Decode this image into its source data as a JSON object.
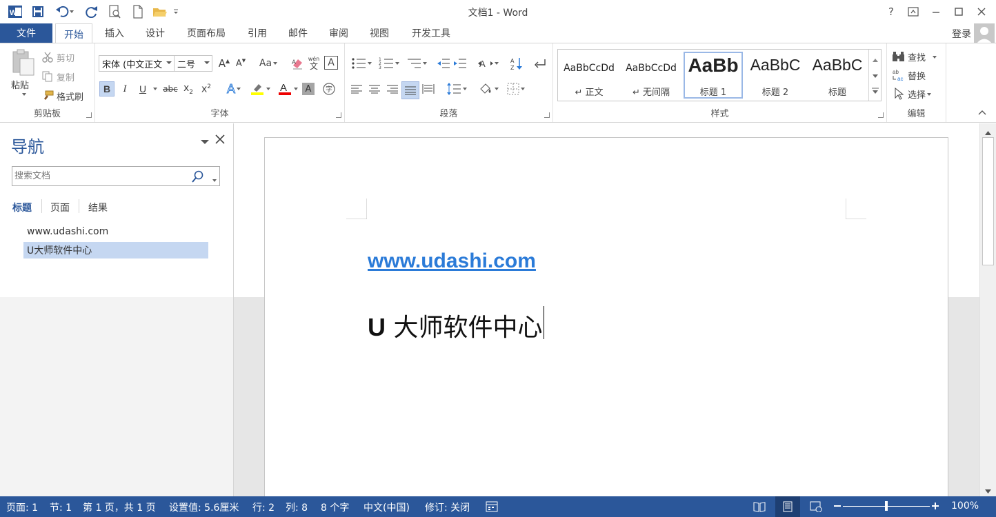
{
  "window": {
    "title": "文档1 - Word",
    "help": "?"
  },
  "tabs": [
    {
      "label": "文件"
    },
    {
      "label": "开始"
    },
    {
      "label": "插入"
    },
    {
      "label": "设计"
    },
    {
      "label": "页面布局"
    },
    {
      "label": "引用"
    },
    {
      "label": "邮件"
    },
    {
      "label": "审阅"
    },
    {
      "label": "视图"
    },
    {
      "label": "开发工具"
    }
  ],
  "account": {
    "signin": "登录"
  },
  "ribbon": {
    "clipboard": {
      "label": "剪贴板",
      "paste": "粘贴",
      "cut": "剪切",
      "copy": "复制",
      "format_painter": "格式刷"
    },
    "font": {
      "label": "字体",
      "font_name": "宋体 (中文正文",
      "font_size": "二号",
      "change_case": "Aa",
      "phonetic_top": "wén",
      "phonetic_bottom": "文"
    },
    "paragraph": {
      "label": "段落"
    },
    "styles": {
      "label": "样式",
      "items": [
        {
          "preview": "AaBbCcDd",
          "name": "正文"
        },
        {
          "preview": "AaBbCcDd",
          "name": "无间隔"
        },
        {
          "preview": "AaBb",
          "name": "标题 1"
        },
        {
          "preview": "AaBbC",
          "name": "标题 2"
        },
        {
          "preview": "AaBbC",
          "name": "标题"
        }
      ]
    },
    "editing": {
      "label": "编辑",
      "find": "查找",
      "replace": "替换",
      "select": "选择"
    }
  },
  "nav": {
    "title": "导航",
    "search_placeholder": "搜索文档",
    "tabs": [
      "标题",
      "页面",
      "结果"
    ],
    "headings": [
      "www.udashi.com",
      "U大师软件中心"
    ]
  },
  "document": {
    "link": "www.udashi.com",
    "heading_letter": "U",
    "heading_rest": " 大师软件中心"
  },
  "status": {
    "page": "页面: 1",
    "section": "节: 1",
    "page_of": "第 1 页，共 1 页",
    "position": "设置值: 5.6厘米",
    "line": "行: 2",
    "column": "列: 8",
    "words": "8 个字",
    "language": "中文(中国)",
    "track": "修订: 关闭",
    "zoom": "100%",
    "zoom_level": 1.0
  },
  "colors": {
    "accent": "#2b579a",
    "link": "#2b7bd8",
    "selection": "#c5d7f1"
  }
}
